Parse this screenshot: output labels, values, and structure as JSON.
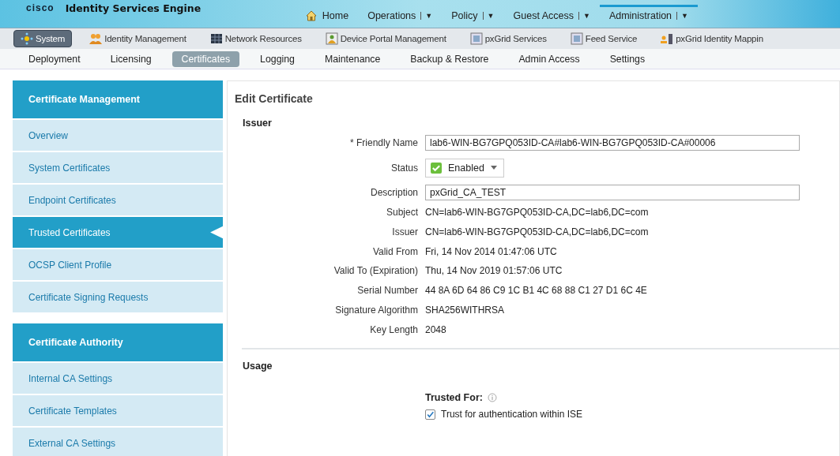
{
  "header": {
    "logo": "cisco",
    "title": "Identity Services Engine"
  },
  "top_nav": [
    {
      "label": "Home",
      "kind": "home",
      "selected": false
    },
    {
      "label": "Operations",
      "kind": "menu",
      "arrow": "▼",
      "selected": false
    },
    {
      "label": "Policy",
      "kind": "menu",
      "arrow": "▼",
      "selected": false
    },
    {
      "label": "Guest Access",
      "kind": "menu",
      "arrow": "▼",
      "selected": false
    },
    {
      "label": "Administration",
      "kind": "menu",
      "arrow": "▼",
      "selected": true
    }
  ],
  "module_tabs": [
    {
      "label": "System",
      "kind": "system",
      "selected": true
    },
    {
      "label": "Identity Management",
      "kind": "people",
      "selected": false
    },
    {
      "label": "Network Resources",
      "kind": "grid",
      "selected": false
    },
    {
      "label": "Device Portal Management",
      "kind": "portal",
      "selected": false
    },
    {
      "label": "pxGrid Services",
      "kind": "service",
      "selected": false
    },
    {
      "label": "Feed Service",
      "kind": "service",
      "selected": false
    },
    {
      "label": "pxGrid Identity Mappin",
      "kind": "mapping",
      "selected": false
    }
  ],
  "sub_tabs": [
    {
      "label": "Deployment",
      "selected": false
    },
    {
      "label": "Licensing",
      "selected": false
    },
    {
      "label": "Certificates",
      "selected": true
    },
    {
      "label": "Logging",
      "selected": false
    },
    {
      "label": "Maintenance",
      "selected": false
    },
    {
      "label": "Backup & Restore",
      "selected": false
    },
    {
      "label": "Admin Access",
      "selected": false
    },
    {
      "label": "Settings",
      "selected": false
    }
  ],
  "sidebar": [
    {
      "title": "Certificate Management",
      "items": [
        {
          "label": "Overview",
          "selected": false
        },
        {
          "label": "System Certificates",
          "selected": false
        },
        {
          "label": "Endpoint Certificates",
          "selected": false
        },
        {
          "label": "Trusted Certificates",
          "selected": true
        },
        {
          "label": "OCSP Client Profile",
          "selected": false
        },
        {
          "label": "Certificate Signing Requests",
          "selected": false
        }
      ]
    },
    {
      "title": "Certificate Authority",
      "items": [
        {
          "label": "Internal CA Settings",
          "selected": false
        },
        {
          "label": "Certificate Templates",
          "selected": false
        },
        {
          "label": "External CA Settings",
          "selected": false
        }
      ]
    }
  ],
  "page_title": "Edit Certificate",
  "issuer": {
    "title": "Issuer",
    "fields": [
      {
        "label": "* Friendly Name",
        "kind": "input",
        "value": "lab6-WIN-BG7GPQ053ID-CA#lab6-WIN-BG7GPQ053ID-CA#00006"
      },
      {
        "label": "Status",
        "kind": "select",
        "value": "Enabled",
        "checked": true
      },
      {
        "label": "Description",
        "kind": "input",
        "value": "pxGrid_CA_TEST"
      },
      {
        "label": "Subject",
        "kind": "text",
        "value": "CN=lab6-WIN-BG7GPQ053ID-CA,DC=lab6,DC=com"
      },
      {
        "label": "Issuer",
        "kind": "text",
        "value": "CN=lab6-WIN-BG7GPQ053ID-CA,DC=lab6,DC=com"
      },
      {
        "label": "Valid From",
        "kind": "text",
        "value": "Fri, 14 Nov 2014 01:47:06 UTC"
      },
      {
        "label": "Valid To (Expiration)",
        "kind": "text",
        "value": "Thu, 14 Nov 2019 01:57:06 UTC"
      },
      {
        "label": "Serial Number",
        "kind": "text",
        "value": "44 8A 6D 64 86 C9 1C B1 4C 68 88 C1 27 D1 6C 4E"
      },
      {
        "label": "Signature Algorithm",
        "kind": "text",
        "value": "SHA256WITHRSA"
      },
      {
        "label": "Key Length",
        "kind": "text",
        "value": "2048"
      }
    ]
  },
  "usage": {
    "title": "Usage",
    "trusted_for_label": "Trusted For:",
    "options": [
      {
        "label": "Trust for authentication within ISE",
        "checked": true
      }
    ]
  }
}
